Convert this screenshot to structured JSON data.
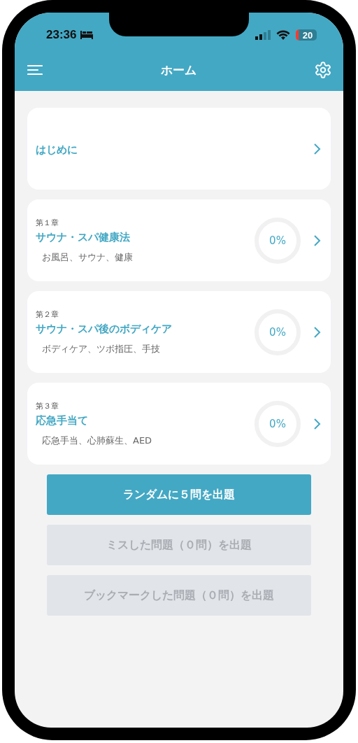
{
  "status_bar": {
    "time": "23:36",
    "battery": "20",
    "battery_low": true
  },
  "header": {
    "title": "ホーム"
  },
  "intro": {
    "title": "はじめに"
  },
  "chapters": [
    {
      "number": "第１章",
      "title": "サウナ・スパ健康法",
      "topics": "お風呂、サウナ、健康",
      "progress": "0%"
    },
    {
      "number": "第２章",
      "title": "サウナ・スパ後のボディケア",
      "topics": "ボディケア、ツボ指圧、手技",
      "progress": "0%"
    },
    {
      "number": "第３章",
      "title": "応急手当て",
      "topics": "応急手当、心肺蘇生、AED",
      "progress": "0%"
    }
  ],
  "buttons": [
    {
      "label": "ランダムに５問を出題",
      "disabled": false
    },
    {
      "label": "ミスした問題（０問）を出題",
      "disabled": true
    },
    {
      "label": "ブックマークした問題（０問）を出題",
      "disabled": true
    }
  ]
}
